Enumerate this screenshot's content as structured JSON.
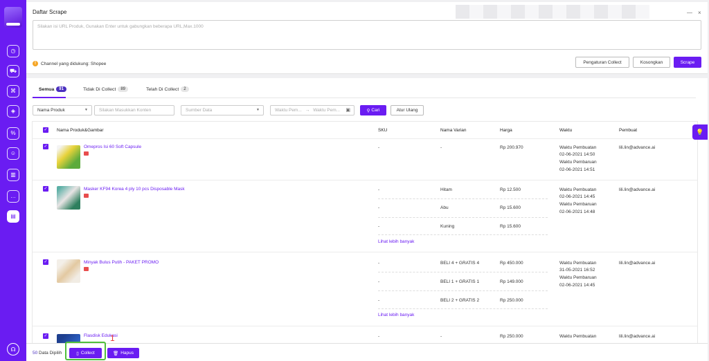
{
  "page_title": "Daftar Scrape",
  "url_input": {
    "placeholder": "Silakan isi URL Produk, Gunakan Enter untuk gabungkan beberapa URL,Max.1000"
  },
  "supported_channels": "Channel yang didukung: Shopee",
  "actions": {
    "settings": "Pengaturan Collect",
    "clear": "Kosongkan",
    "scrape": "Scrape"
  },
  "tabs": [
    {
      "label": "Semua",
      "count": "91"
    },
    {
      "label": "Tidak Di Collect",
      "count": "89"
    },
    {
      "label": "Telah Di Collect",
      "count": "2"
    }
  ],
  "filters": {
    "field_select": "Nama Produk",
    "keyword_placeholder": "Silakan Masukkan Konten",
    "source_placeholder": "Sumber Data",
    "time_start_placeholder": "Waktu Pem...",
    "time_end_placeholder": "Waktu Pem...",
    "arrow": "→",
    "search": "Cari",
    "reset": "Atur Ulang"
  },
  "table": {
    "headers": {
      "name": "Nama Produk&Gambar",
      "sku": "SKU",
      "variant": "Nama Varian",
      "price": "Harga",
      "time": "Waktu",
      "creator": "Pembuat"
    },
    "created_label": "Waktu Pembuatan",
    "updated_label": "Waktu Pembaruan",
    "see_more": "Lihat lebih banyak",
    "rows": [
      {
        "name": "Omepros Isi 60 Soft Capsule",
        "variants": [
          {
            "sku": "-",
            "variant": "-",
            "price": "Rp 200.970"
          }
        ],
        "created": "02-06-2021 14:50",
        "updated": "02-06-2021 14:51",
        "creator": "lili.lin@advance.ai"
      },
      {
        "name": "Masker KF94 Korea 4 ply 10 pcs Disposable Mask",
        "variants": [
          {
            "sku": "-",
            "variant": "Hitam",
            "price": "Rp 12.500"
          },
          {
            "sku": "-",
            "variant": "Abu",
            "price": "Rp 15.600"
          },
          {
            "sku": "-",
            "variant": "Kuning",
            "price": "Rp 15.600"
          }
        ],
        "created": "02-06-2021 14:45",
        "updated": "02-06-2021 14:48",
        "creator": "lili.lin@advance.ai"
      },
      {
        "name": "Minyak Bulus Putih - PAKET PROMO",
        "variants": [
          {
            "sku": "-",
            "variant": "BELI 4 + GRATIS 4",
            "price": "Rp 450.000"
          },
          {
            "sku": "-",
            "variant": "BELI 1 + GRATIS 1",
            "price": "Rp 149.000"
          },
          {
            "sku": "-",
            "variant": "BELI 2 + GRATIS 2",
            "price": "Rp 250.000"
          }
        ],
        "created": "31-05-2021 16:52",
        "updated": "02-06-2021 14:45",
        "creator": "lili.lin@advance.ai"
      },
      {
        "name": "Flasdisk Edukasi",
        "variants": [
          {
            "sku": "-",
            "variant": "-",
            "price": "Rp 250.000"
          }
        ],
        "creator": "lili.lin@advance.ai"
      }
    ]
  },
  "footer": {
    "count": "50",
    "selected_label": "Data Dipilih",
    "collect": "Collect",
    "delete": "Hapus"
  },
  "annotation_number": "1",
  "colors": {
    "accent": "#6a1cf2",
    "highlight_box": "#4fbf3a",
    "annotation": "#e83232"
  }
}
